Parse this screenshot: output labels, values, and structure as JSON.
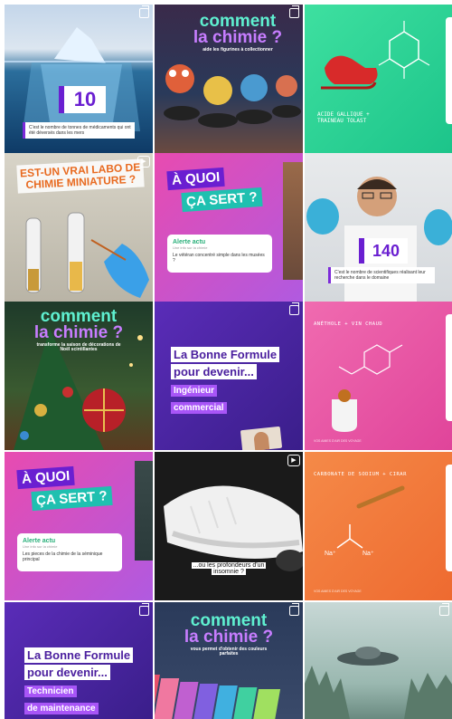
{
  "tiles": [
    {
      "id": "iceberg",
      "number": "10",
      "caption": "C'est le nombre de tonnes de médicaments qui ont été déversés dans les mers"
    },
    {
      "id": "comment-chimie-figurines",
      "title_w1": "comment",
      "title_w2": "la chimie ?",
      "subtitle": "aide les figurines à collectionner"
    },
    {
      "id": "molecule-sleigh",
      "label": "ACIDE GALLIQUE + TRAINEAU TOLAST"
    },
    {
      "id": "labo-miniature",
      "title": "EST-UN VRAI LABO DE CHIMIE MINIATURE ?"
    },
    {
      "id": "a-quoi-ca-sert-1",
      "line1": "À QUOI",
      "line2": "ÇA SERT ?",
      "card_title": "Alerte actu",
      "card_sub": "Une info sur la chimie",
      "card_desc": "Le vétéran concentré simple dans les musées ?"
    },
    {
      "id": "scientist-140",
      "number": "140",
      "caption": "C'est le nombre de scientifiques réalisant leur recherche dans le domaine"
    },
    {
      "id": "comment-chimie-noel",
      "title_w1": "comment",
      "title_w2": "la chimie ?",
      "subtitle": "transforme la saison de décorations de Noël scintillantes"
    },
    {
      "id": "bonne-formule-ingenieur",
      "line1": "La Bonne Formule",
      "line2": "pour devenir...",
      "role1": "Ingénieur",
      "role2": "commercial"
    },
    {
      "id": "anethole-vin-chaud",
      "label": "ANÉTHOLE + VIN CHAUD",
      "footer": "VOS AMIES D'AIR DES VOYAGE"
    },
    {
      "id": "a-quoi-ca-sert-2",
      "line1": "À QUOI",
      "line2": "ÇA SERT ?",
      "card_title": "Alerte actu",
      "card_sub": "Une info sur la chimie",
      "card_desc": "Les pieces de la chimie de la séminique principal"
    },
    {
      "id": "sneaker",
      "subtitle1": "...ou les profondeurs d'un",
      "subtitle2": "insomnie ?"
    },
    {
      "id": "carbonate-sodium",
      "label": "CARBONATE DE SODIUM + CIRAR",
      "ion1": "Na⁺",
      "ion2": "Na⁺",
      "footer": "VOS AMIES D'AIR DES VOYAGE"
    },
    {
      "id": "bonne-formule-technicien",
      "line1": "La Bonne Formule",
      "line2": "pour devenir...",
      "role1": "Technicien",
      "role2": "de maintenance"
    },
    {
      "id": "comment-chimie-colors",
      "title_w1": "comment",
      "title_w2": "la chimie ?",
      "subtitle": "vous permet d'obtenir des couleurs parfaites"
    },
    {
      "id": "ufo-forest"
    }
  ],
  "colors": {
    "purple": "#6a1fd1",
    "teal": "#1fc0b0",
    "pink": "#ec4ba3",
    "orange": "#f47a3b",
    "green": "#2fd08a"
  }
}
